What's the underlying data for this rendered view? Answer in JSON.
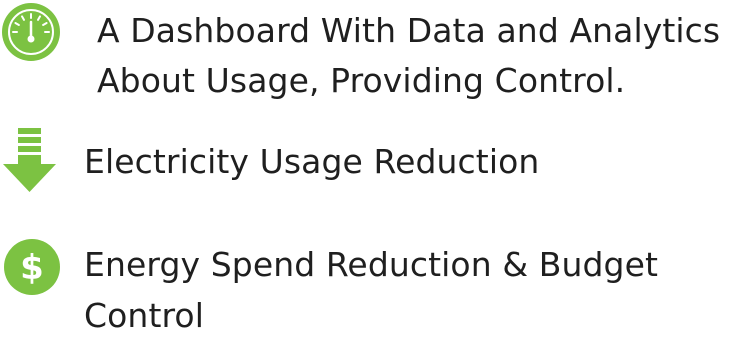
{
  "accent_color": "#7cc242",
  "features": [
    {
      "icon": "speedometer-icon",
      "lines": [
        "A Dashboard With Data and Analytics",
        "About Usage, Providing Control."
      ]
    },
    {
      "icon": "down-arrow-icon",
      "lines": [
        "Electricity Usage Reduction"
      ]
    },
    {
      "icon": "dollar-icon",
      "symbol": "$",
      "lines": [
        "Energy Spend Reduction & Budget",
        "Control"
      ]
    }
  ]
}
